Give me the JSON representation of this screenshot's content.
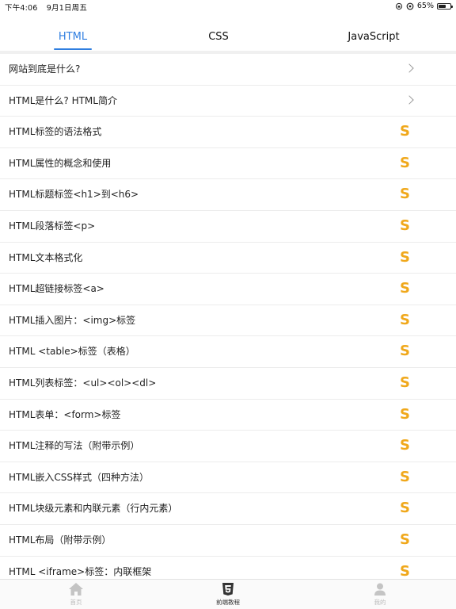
{
  "status": {
    "time": "下午4:06",
    "date": "9月1日周五",
    "battery": "65%",
    "battery_level": 0.65
  },
  "tabs": [
    {
      "label": "HTML",
      "active": true
    },
    {
      "label": "CSS",
      "active": false
    },
    {
      "label": "JavaScript",
      "active": false
    }
  ],
  "colors": {
    "accent": "#2f7ee0",
    "coin": "#f0a81b"
  },
  "list": [
    {
      "title": "网站到底是什么?",
      "trailing": "chevron-right-icon"
    },
    {
      "title": "HTML是什么? HTML简介",
      "trailing": "chevron-right-icon"
    },
    {
      "title": "HTML标签的语法格式",
      "trailing": "coin-icon"
    },
    {
      "title": "HTML属性的概念和使用",
      "trailing": "coin-icon"
    },
    {
      "title": "HTML标题标签<h1>到<h6>",
      "trailing": "coin-icon"
    },
    {
      "title": "HTML段落标签<p>",
      "trailing": "coin-icon"
    },
    {
      "title": "HTML文本格式化",
      "trailing": "coin-icon"
    },
    {
      "title": "HTML超链接标签<a>",
      "trailing": "coin-icon"
    },
    {
      "title": "HTML插入图片：<img>标签",
      "trailing": "coin-icon"
    },
    {
      "title": "HTML <table>标签（表格）",
      "trailing": "coin-icon"
    },
    {
      "title": "HTML列表标签：<ul><ol><dl>",
      "trailing": "coin-icon"
    },
    {
      "title": "HTML表单：<form>标签",
      "trailing": "coin-icon"
    },
    {
      "title": "HTML注释的写法（附带示例）",
      "trailing": "coin-icon"
    },
    {
      "title": "HTML嵌入CSS样式（四种方法）",
      "trailing": "coin-icon"
    },
    {
      "title": "HTML块级元素和内联元素（行内元素）",
      "trailing": "coin-icon"
    },
    {
      "title": "HTML布局（附带示例）",
      "trailing": "coin-icon"
    },
    {
      "title": "HTML <iframe>标签：内联框架",
      "trailing": "coin-icon"
    }
  ],
  "coin_glyph": "S",
  "tabbar": [
    {
      "label": "首页",
      "icon": "home-icon",
      "active": false
    },
    {
      "label": "前端教程",
      "icon": "html5-icon",
      "active": true
    },
    {
      "label": "我的",
      "icon": "user-icon",
      "active": false
    }
  ]
}
